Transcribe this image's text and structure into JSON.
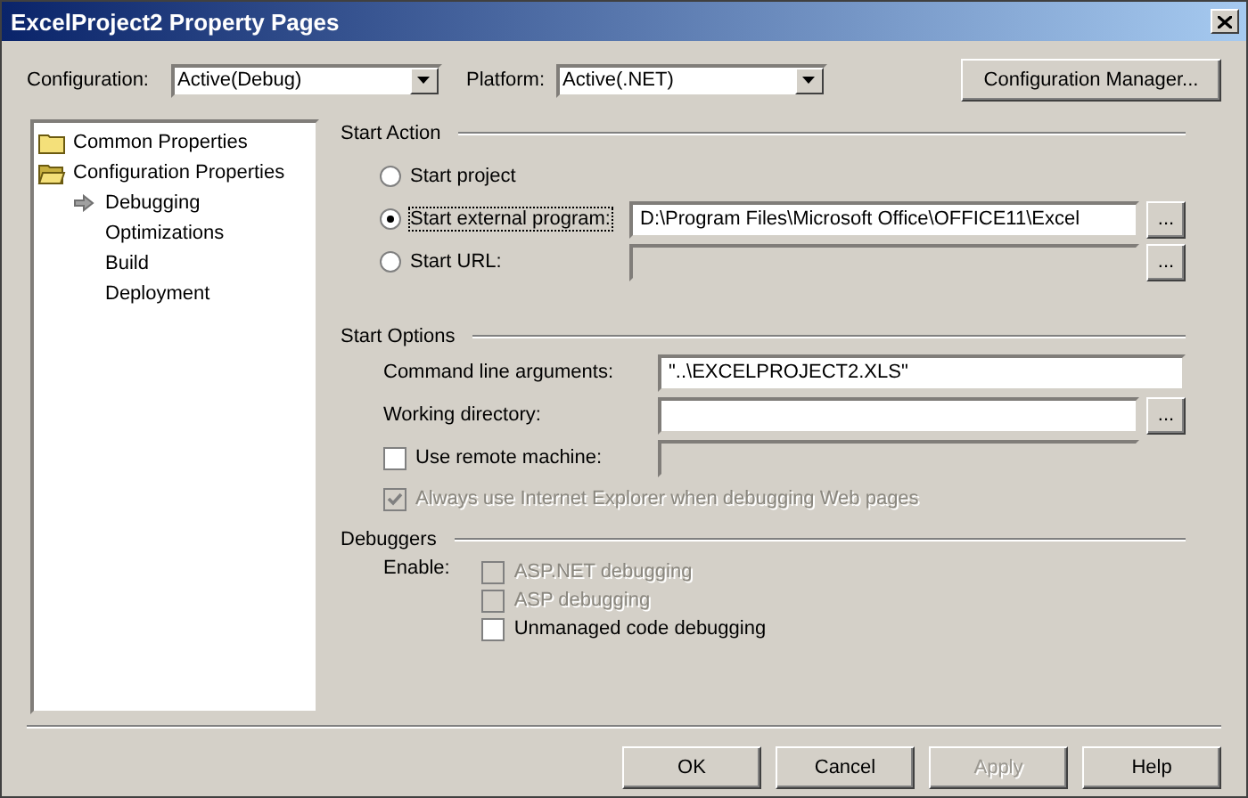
{
  "window": {
    "title": "ExcelProject2 Property Pages"
  },
  "toolbar": {
    "configuration": {
      "label": "Configuration:",
      "value": "Active(Debug)"
    },
    "platform": {
      "label": "Platform:",
      "value": "Active(.NET)"
    },
    "manager_button": "Configuration Manager..."
  },
  "tree": [
    {
      "label": "Common Properties",
      "expanded": false,
      "selected": false
    },
    {
      "label": "Configuration Properties",
      "expanded": true,
      "selected": false,
      "children": [
        {
          "label": "Debugging",
          "selected": true
        },
        {
          "label": "Optimizations",
          "selected": false
        },
        {
          "label": "Build",
          "selected": false
        },
        {
          "label": "Deployment",
          "selected": false
        }
      ]
    }
  ],
  "start_action": {
    "heading": "Start Action",
    "options": [
      {
        "label": "Start project",
        "selected": false,
        "kind": "plain"
      },
      {
        "label": "Start external program:",
        "selected": true,
        "kind": "field",
        "value": "D:\\Program Files\\Microsoft Office\\OFFICE11\\Excel",
        "disabled": false,
        "browse": "..."
      },
      {
        "label": "Start URL:",
        "selected": false,
        "kind": "field",
        "disabled": true,
        "browse": "..."
      }
    ]
  },
  "start_options": {
    "heading": "Start Options",
    "rows": [
      {
        "kind": "field",
        "label": "Command line arguments:",
        "value": "\"..\\EXCELPROJECT2.XLS\"",
        "disabled": false
      },
      {
        "kind": "field",
        "label": "Working directory:",
        "disabled": false,
        "browse": "..."
      },
      {
        "kind": "checkfield",
        "label": "Use remote machine:",
        "checked": false,
        "disabled": false,
        "field_disabled": true
      },
      {
        "kind": "check",
        "label": "Always use Internet Explorer when debugging Web pages",
        "checked": true,
        "disabled": true
      }
    ]
  },
  "debuggers": {
    "heading": "Debuggers",
    "enable_label": "Enable:",
    "options": [
      {
        "label": "ASP.NET debugging",
        "checked": false,
        "disabled": true
      },
      {
        "label": "ASP debugging",
        "checked": false,
        "disabled": true
      },
      {
        "label": "Unmanaged code debugging",
        "checked": false,
        "disabled": false
      }
    ]
  },
  "buttons": [
    {
      "label": "OK",
      "disabled": false
    },
    {
      "label": "Cancel",
      "disabled": false
    },
    {
      "label": "Apply",
      "disabled": true
    },
    {
      "label": "Help",
      "disabled": false
    }
  ]
}
